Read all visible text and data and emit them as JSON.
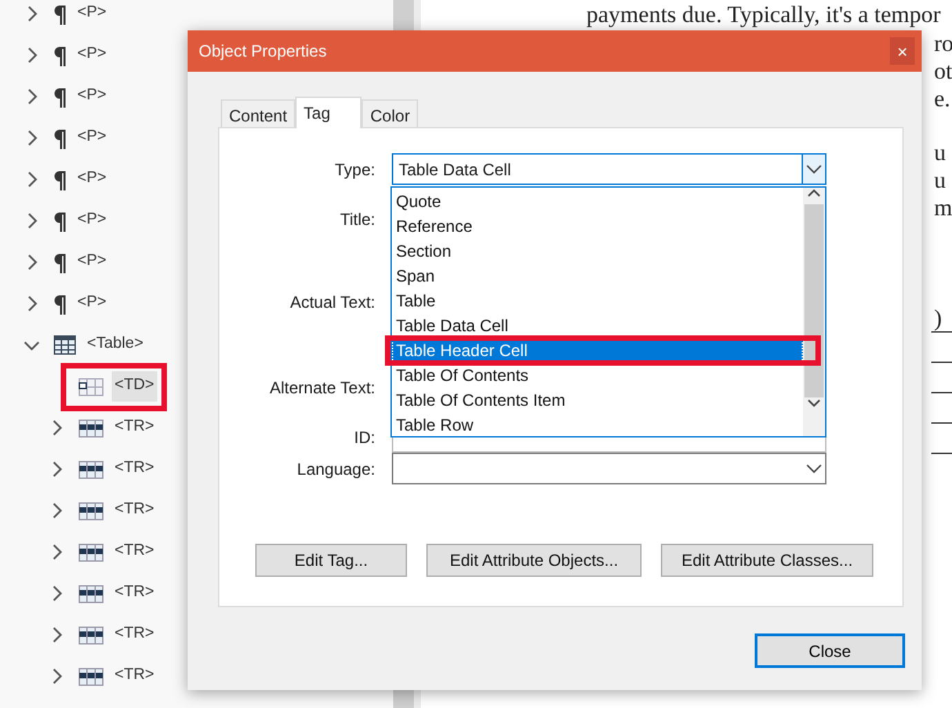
{
  "tags_tree": [
    {
      "tag": "<P>",
      "kind": "paragraph",
      "expanded": false,
      "selected": false,
      "highlighted": false
    },
    {
      "tag": "<P>",
      "kind": "paragraph",
      "expanded": false,
      "selected": false,
      "highlighted": false
    },
    {
      "tag": "<P>",
      "kind": "paragraph",
      "expanded": false,
      "selected": false,
      "highlighted": false
    },
    {
      "tag": "<P>",
      "kind": "paragraph",
      "expanded": false,
      "selected": false,
      "highlighted": false
    },
    {
      "tag": "<P>",
      "kind": "paragraph",
      "expanded": false,
      "selected": false,
      "highlighted": false
    },
    {
      "tag": "<P>",
      "kind": "paragraph",
      "expanded": false,
      "selected": false,
      "highlighted": false
    },
    {
      "tag": "<P>",
      "kind": "paragraph",
      "expanded": false,
      "selected": false,
      "highlighted": false
    },
    {
      "tag": "<P>",
      "kind": "paragraph",
      "expanded": false,
      "selected": false,
      "highlighted": false
    },
    {
      "tag": "<Table>",
      "kind": "table",
      "expanded": true,
      "selected": false,
      "highlighted": false,
      "children": [
        {
          "tag": "<TD>",
          "kind": "cell",
          "selected": true,
          "highlighted": true
        },
        {
          "tag": "<TR>",
          "kind": "row",
          "expanded": false,
          "selected": false,
          "highlighted": false
        },
        {
          "tag": "<TR>",
          "kind": "row",
          "expanded": false,
          "selected": false,
          "highlighted": false
        },
        {
          "tag": "<TR>",
          "kind": "row",
          "expanded": false,
          "selected": false,
          "highlighted": false
        },
        {
          "tag": "<TR>",
          "kind": "row",
          "expanded": false,
          "selected": false,
          "highlighted": false
        },
        {
          "tag": "<TR>",
          "kind": "row",
          "expanded": false,
          "selected": false,
          "highlighted": false
        },
        {
          "tag": "<TR>",
          "kind": "row",
          "expanded": false,
          "selected": false,
          "highlighted": false
        },
        {
          "tag": "<TR>",
          "kind": "row",
          "expanded": false,
          "selected": false,
          "highlighted": false
        }
      ]
    }
  ],
  "document": {
    "first_line": "payments due. Typically, it's a tempor",
    "fragments": [
      "ro",
      "ot",
      "e.",
      "u",
      "u",
      "m",
      ")"
    ]
  },
  "dialog": {
    "title": "Object Properties",
    "close": "×",
    "tabs": [
      {
        "label": "Content",
        "selected": false
      },
      {
        "label": "Tag",
        "selected": true
      },
      {
        "label": "Color",
        "selected": false
      }
    ],
    "fields": [
      {
        "label": "Type:",
        "kind": "combo",
        "value": "Table Data Cell",
        "open": true
      },
      {
        "label": "Title:",
        "kind": "hidden"
      },
      {
        "label": "Actual Text:",
        "kind": "hidden"
      },
      {
        "label": "Alternate Text:",
        "kind": "hidden"
      },
      {
        "label": "ID:",
        "kind": "text"
      },
      {
        "label": "Language:",
        "kind": "combo",
        "open": false
      }
    ],
    "type_options": [
      {
        "label": "Quote",
        "selected": false,
        "highlighted": false
      },
      {
        "label": "Reference",
        "selected": false,
        "highlighted": false
      },
      {
        "label": "Section",
        "selected": false,
        "highlighted": false
      },
      {
        "label": "Span",
        "selected": false,
        "highlighted": false
      },
      {
        "label": "Table",
        "selected": false,
        "highlighted": false
      },
      {
        "label": "Table Data Cell",
        "selected": false,
        "highlighted": false
      },
      {
        "label": "Table Header Cell",
        "selected": true,
        "highlighted": true
      },
      {
        "label": "Table Of Contents",
        "selected": false,
        "highlighted": false
      },
      {
        "label": "Table Of Contents Item",
        "selected": false,
        "highlighted": false
      },
      {
        "label": "Table Row",
        "selected": false,
        "highlighted": false
      }
    ],
    "buttons": [
      "Edit Tag...",
      "Edit Attribute Objects...",
      "Edit Attribute Classes..."
    ],
    "close_button": "Close"
  }
}
